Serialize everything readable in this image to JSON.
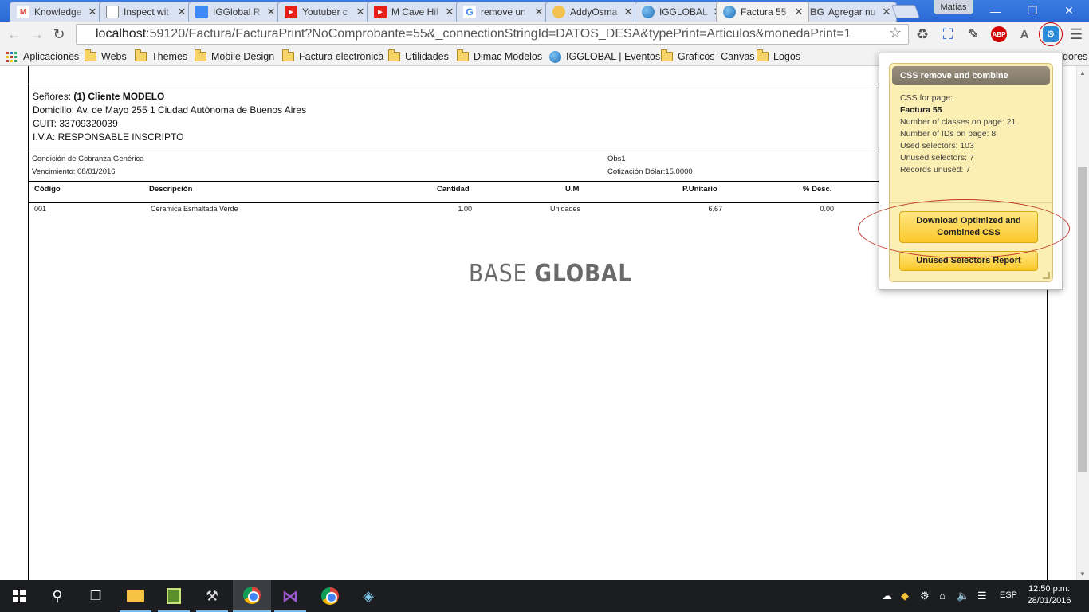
{
  "browser": {
    "tabs": [
      {
        "title": "Knowledge",
        "fav": "M",
        "fav_color": "#db4437"
      },
      {
        "title": "Inspect wit",
        "fav": "",
        "fav_color": "#ffffff"
      },
      {
        "title": "IGGlobal R",
        "fav": "",
        "fav_color": "#3d8af7"
      },
      {
        "title": "Youtuber c",
        "fav": "▶",
        "fav_color": "#e62117"
      },
      {
        "title": "M Cave Hil",
        "fav": "▶",
        "fav_color": "#e62117"
      },
      {
        "title": "remove un",
        "fav": "G",
        "fav_color": "#4285f4"
      },
      {
        "title": "AddyOsma",
        "fav": "",
        "fav_color": "#f2c14e"
      },
      {
        "title": "IGGLOBAL",
        "fav": "",
        "fav_color": "#2f7fd0"
      },
      {
        "title": "Factura 55",
        "fav": "",
        "fav_color": "#2f7fd0",
        "active": true
      },
      {
        "title": "Agregar nu",
        "fav": "BG",
        "fav_color": "#555555"
      }
    ],
    "profile_name": "Matías",
    "url_host": "localhost",
    "url_path": ":59120/Factura/FacturaPrint?NoComprobante=55&_connectionStringId=DATOS_DESA&typePrint=Articulos&monedaPrint=1",
    "extensions": {
      "abp": "ABP",
      "a": "A"
    },
    "bookmarks": [
      {
        "label": "Aplicaciones",
        "type": "apps"
      },
      {
        "label": "Webs",
        "type": "folder"
      },
      {
        "label": "Themes",
        "type": "folder"
      },
      {
        "label": "Mobile Design",
        "type": "folder"
      },
      {
        "label": "Factura electronica",
        "type": "folder"
      },
      {
        "label": "Utilidades",
        "type": "folder"
      },
      {
        "label": "Dimac Modelos",
        "type": "folder"
      },
      {
        "label": "IGGLOBAL | Eventos",
        "type": "globe"
      },
      {
        "label": "Graficos- Canvas",
        "type": "folder"
      },
      {
        "label": "Logos",
        "type": "folder"
      }
    ],
    "bookmarks_overflow": "dores"
  },
  "invoice": {
    "senores_label": "Señores:",
    "client_name": "(1) Cliente MODELO",
    "domicilio": "Domicilio: Av. de Mayo 255 1 Ciudad Autònoma de Buenos Aires",
    "cuit": "CUIT: 33709320039",
    "iva": "I.V.A: RESPONSABLE INSCRIPTO",
    "condicion": "Condición de Cobranza Genérica",
    "vencimiento": "Vencimiento: 08/01/2016",
    "obs": "Obs1",
    "cotizacion": "Cotización Dólar:15.0000",
    "columns": [
      "Código",
      "Descripción",
      "Cantidad",
      "U.M",
      "P.Unitario",
      "% Desc."
    ],
    "rows": [
      {
        "codigo": "001",
        "descripcion": "Ceramica Esmaltada Verde",
        "cantidad": "1.00",
        "um": "Unidades",
        "punitario": "6.67",
        "desc": "0.00"
      }
    ],
    "logo_light": "BASE",
    "logo_bold": "GLOBAL"
  },
  "popup": {
    "title": "CSS remove and combine",
    "css_for_page_label": "CSS for page:",
    "page_name": "Factura 55",
    "classes": "Number of classes on page: 21",
    "ids": "Number of IDs on page: 8",
    "used": "Used selectors: 103",
    "unused": "Unused selectors: 7",
    "records_unused": "Records unused: 7",
    "download_button": "Download Optimized and Combined CSS",
    "report_button": "Unused Selectors Report"
  },
  "taskbar": {
    "lang": "ESP",
    "time": "12:50 p.m.",
    "date": "28/01/2016"
  }
}
